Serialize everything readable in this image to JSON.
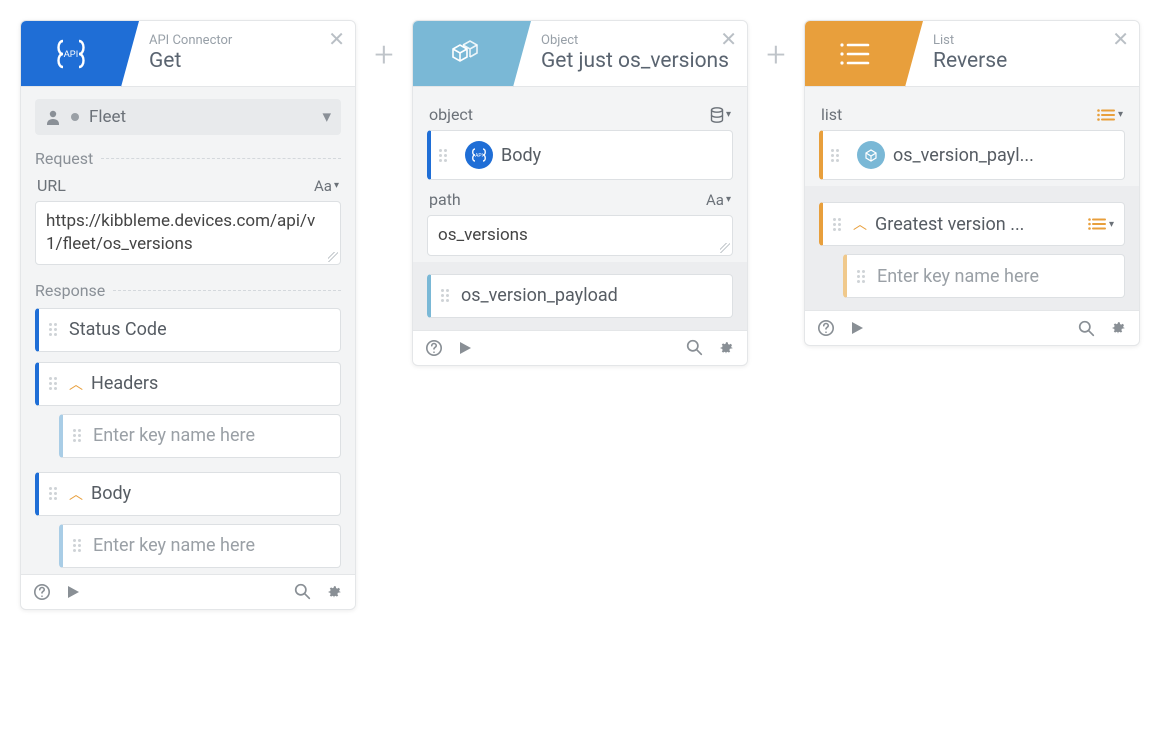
{
  "cards": {
    "get": {
      "category": "API Connector",
      "title": "Get",
      "account": "Fleet",
      "sections": {
        "request_label": "Request",
        "url_label": "URL",
        "url_value": "https://kibbleme.devices.com/api/v1/fleet/os_versions",
        "response_label": "Response",
        "status_code": "Status Code",
        "headers": "Headers",
        "body": "Body",
        "key_placeholder": "Enter key name here"
      }
    },
    "object": {
      "category": "Object",
      "title": "Get just os_versions",
      "object_label": "object",
      "object_chip": "Body",
      "path_label": "path",
      "path_value": "os_versions",
      "output": "os_version_payload"
    },
    "list": {
      "category": "List",
      "title": "Reverse",
      "list_label": "list",
      "list_chip": "os_version_payl...",
      "sort": "Greatest version ...",
      "key_placeholder": "Enter key name here"
    }
  },
  "glyphs": {
    "plus": "+",
    "close": "✕",
    "aa": "Aa",
    "caret_down": "▾",
    "caret_up": "︿"
  }
}
